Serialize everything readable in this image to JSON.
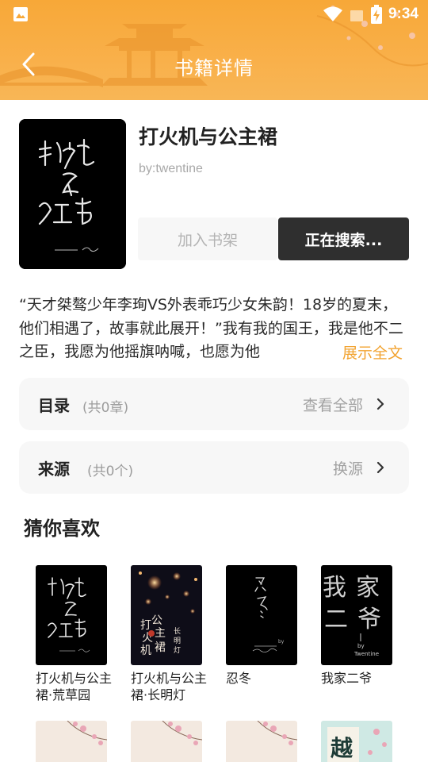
{
  "header": {
    "title": "书籍详情",
    "time": "9:34"
  },
  "book": {
    "title": "打火机与公主裙",
    "author": "by:twentine",
    "buttons": {
      "add_shelf": "加入书架",
      "searching": "正在搜索..."
    },
    "intro": "“天才桀骜少年李珣VS外表乖巧少女朱韵！18岁的夏末，他们相遇了，故事就此展开！”我有我的国王，我是他不二之臣，我愿为他摇旗呐喊，也愿为他",
    "show_all": "展示全文"
  },
  "catalog": {
    "label": "目录",
    "count": "(共0章)",
    "action": "查看全部"
  },
  "source": {
    "label": "来源",
    "count": "(共0个)",
    "action": "换源"
  },
  "recommend": {
    "title": "猜你喜欢",
    "items": [
      {
        "name": "打火机与公主裙·荒草园"
      },
      {
        "name": "打火机与公主裙·长明灯"
      },
      {
        "name": "忍冬"
      },
      {
        "name": "我家二爷"
      }
    ]
  },
  "colors": {
    "header": "#f7a838",
    "accent": "#f2a330",
    "primary_button": "#2f2f2f",
    "card_bg": "#f7f7f7"
  },
  "icons": [
    "image-icon",
    "wifi-icon",
    "battery-icon",
    "back-arrow-icon",
    "chevron-right-icon"
  ]
}
